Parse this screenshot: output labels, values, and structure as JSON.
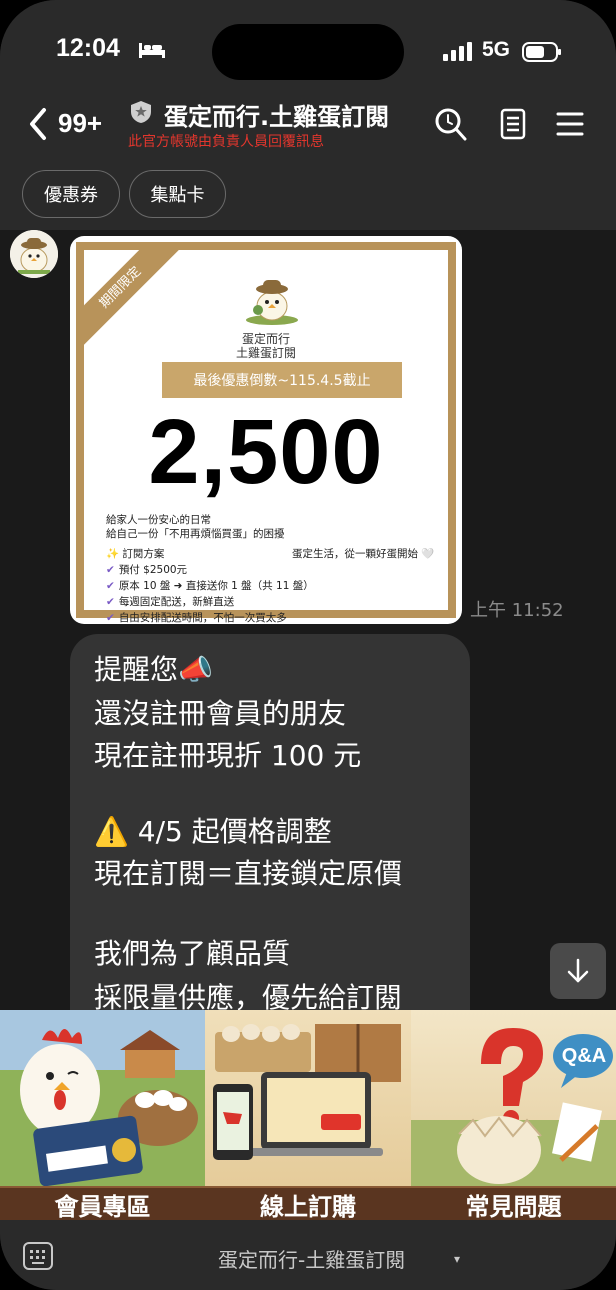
{
  "status_bar": {
    "time": "12:04",
    "network": "5G",
    "icons": [
      "bed-icon",
      "signal-icon",
      "battery-icon"
    ]
  },
  "header": {
    "unread_count": "99+",
    "title": "蛋定而行.土雞蛋訂閱",
    "subtitle": "此官方帳號由負責人員回覆訊息",
    "icons": [
      "back-icon",
      "official-badge-icon",
      "search-icon",
      "notes-icon",
      "menu-icon"
    ]
  },
  "chips": [
    "優惠券",
    "集點卡"
  ],
  "promo": {
    "ribbon": "期間限定",
    "brand_line1": "蛋定而行",
    "brand_line2": "土雞蛋訂閱",
    "deadline": "最後優惠倒數~115.4.5截止",
    "amount": "2,500",
    "tagline1": "給家人一份安心的日常",
    "tagline2": "給自己一份「不用再煩惱買蛋」的困擾",
    "plan_title": "✨ 訂閱方案",
    "slogan": "蛋定生活，從一顆好蛋開始 🤍",
    "plan_items": [
      "預付 $2500元",
      "原本 10 盤 ➜ 直接送你 1 盤（共 11 盤）",
      "每週固定配送，新鮮直送",
      "自由安排配送時間，不怕一次買太多"
    ],
    "timestamp": "上午 11:52"
  },
  "message": {
    "lines": [
      "提醒您📣",
      "還沒註冊會員的朋友",
      "現在註冊現折 100 元",
      "",
      "⚠️ 4/5 起價格調整",
      "現在訂閱＝直接鎖定原價",
      "",
      "我們為了顧品質",
      "採限量供應，優先給訂閱"
    ]
  },
  "rich_menu": {
    "items": [
      "會員專區",
      "線上訂購",
      "常見問題"
    ]
  },
  "bottom_bar": {
    "menu_name": "蛋定而行-土雞蛋訂閱",
    "caret": "▾"
  },
  "colors": {
    "gold": "#b8935a",
    "accent_red": "#e2362d",
    "bubble": "#343434"
  }
}
